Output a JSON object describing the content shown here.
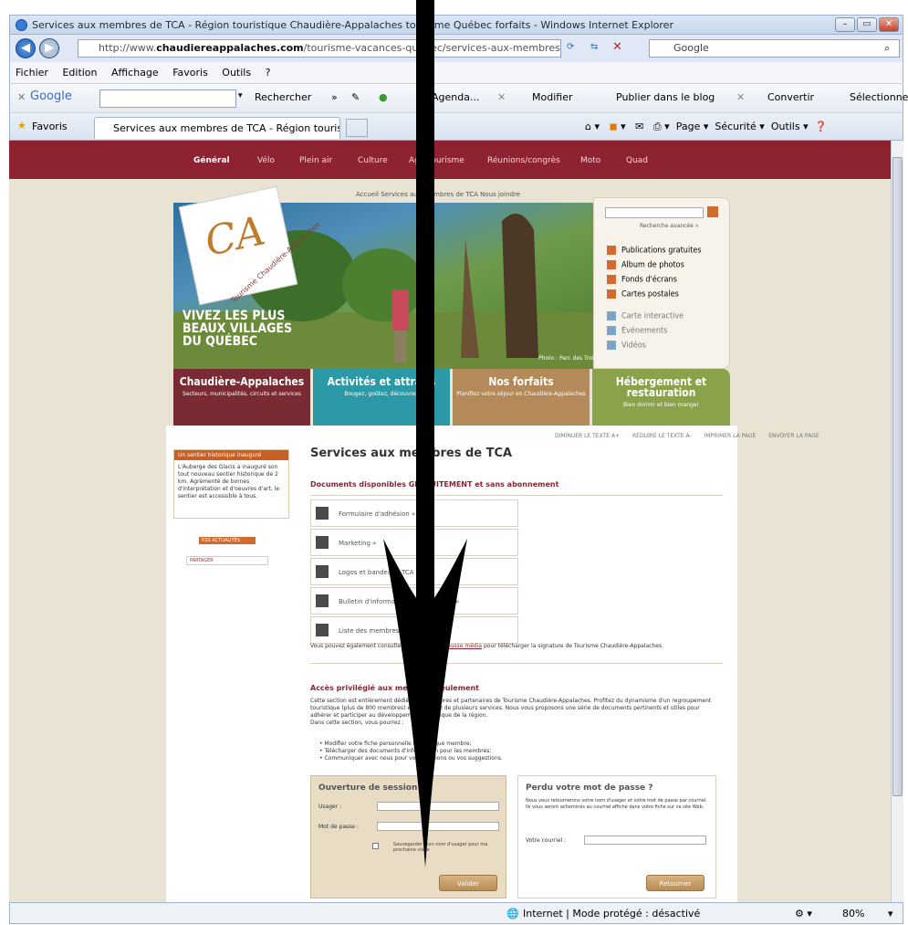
{
  "browser": {
    "title": "Services aux membres de TCA - Région touristique Chaudière-Appalaches tourisme Québec forfaits - Windows Internet Explorer",
    "url_prefix": "http://www.",
    "url_domain": "chaudiereappalaches.com",
    "url_rest": "/tourisme-vacances-quebec/services-aux-membres-c",
    "search_engine": "Google",
    "menu": [
      "Fichier",
      "Edition",
      "Affichage",
      "Favoris",
      "Outils",
      "?"
    ],
    "google_toolbar": {
      "brand": "Google",
      "rechercher": "Rechercher",
      "more": "»",
      "agenda": "Agenda...",
      "modifier": "Modifier",
      "publier": "Publier dans le blog",
      "convertir": "Convertir",
      "selectionner": "Sélectionner"
    },
    "favoris": "Favoris",
    "tab_title": "Services aux membres de TCA - Région touristiqu...",
    "tools": [
      "Page",
      "Sécurité",
      "Outils"
    ],
    "status": "Internet | Mode protégé : désactivé",
    "zoom": "80%"
  },
  "site": {
    "topnav": [
      "Général",
      "Vélo",
      "Plein air",
      "Culture",
      "Agrotourisme",
      "Réunions/congrès",
      "Moto",
      "Quad"
    ],
    "breadcrumb": "Accueil     Services aux membres de TCA     Nous joindre",
    "logo_letters": "CA",
    "logo_text": "Tourisme Chaudière-Appalaches",
    "slogan_1": "VIVEZ LES PLUS",
    "slogan_2": "BEAUX VILLAGES",
    "slogan_3": "DU QUÉBEC",
    "photo_credit": "Photo : Parc des Trois Bérets",
    "advanced_search": "Recherche avancée »",
    "side_links": [
      {
        "label": "Publications gratuites",
        "color": "#d2692e"
      },
      {
        "label": "Album de photos",
        "color": "#d2692e"
      },
      {
        "label": "Fonds d'écrans",
        "color": "#d2692e"
      },
      {
        "label": "Cartes postales",
        "color": "#d2692e"
      },
      {
        "label": "Carte interactive",
        "color": "#7aa7c7"
      },
      {
        "label": "Événements",
        "color": "#7aa7c7"
      },
      {
        "label": "Vidéos",
        "color": "#7aa7c7"
      }
    ],
    "tiles": [
      {
        "title": "Chaudière-Appalaches",
        "sub": "Secteurs, municipalités, circuits et services",
        "color": "#7a2a33"
      },
      {
        "title": "Activités et attraits",
        "sub": "Bougez, goûtez, découvrez",
        "color": "#2b9aa6"
      },
      {
        "title": "Nos forfaits",
        "sub": "Planifiez votre séjour en Chaudière-Appalaches",
        "color": "#b48a5a"
      },
      {
        "title": "Hébergement et restauration",
        "sub": "Bien dormir et bien manger",
        "color": "#8aa24a"
      }
    ],
    "text_tools": [
      "DIMINUER LE TEXTE A+",
      "RÉDUIRE LE TEXTE A-",
      "IMPRIMER LA PAGE",
      "ENVOYER LA PAGE"
    ],
    "news_header": "Un sentier historique inauguré",
    "news_body": "L'Auberge des Glacis a inauguré son tout nouveau sentier historique de 2 km. Agrémenté de bornes d'interprétation et d'oeuvres d'art, le sentier est accessible à tous.",
    "rss_label": "RSS ACTUALITÉS",
    "share_label": "PARTAGER",
    "page_title": "Services aux membres de TCA",
    "docs_title": "Documents disponibles GRATUITEMENT et sans abonnement",
    "docs": [
      "Formulaire d'adhésion »",
      "Marketing »",
      "Logos et bandeaux TCA »",
      "Bulletin d'information aux membres »",
      "Liste des membres »"
    ],
    "note_prefix": "Vous pouvez également consulter notre section ",
    "note_link": "Trousse média",
    "note_suffix": " pour télécharger la signature de Tourisme Chaudière-Appalaches.",
    "members_title": "Accès privilégié aux membres seulement",
    "members_para": "Cette section est entièrement dédiée aux membres et partenaires de Tourisme Chaudière-Appalaches. Profitez du dynamisme d'un regroupement touristique (plus de 800 membres) et bénéficiez de plusieurs services. Nous vous proposons une série de documents pertinents et utiles pour adhérer et participer au développement touristique de la région.",
    "members_intro": "Dans cette section, vous pourrez :",
    "bullets": [
      "Modifier votre fiche personnelle en tant que membre;",
      "Télécharger des documents d'information pour les membres;",
      "Communiquer avec nous pour vos questions ou vos suggestions."
    ],
    "login": {
      "title": "Ouverture de session",
      "user_label": "Usager :",
      "pass_label": "Mot de passe :",
      "remember": "Sauvegarder mon nom d'usager pour ma prochaine visite",
      "button": "Valider"
    },
    "lost": {
      "title": "Perdu votre mot de passe ?",
      "desc": "Nous vous retournerons votre nom d'usager et votre mot de passe par courriel. Ils vous seront acheminés au courriel affiché dans votre fiche sur ce site Web.",
      "email_label": "Votre courriel :",
      "button": "Retourner"
    }
  }
}
